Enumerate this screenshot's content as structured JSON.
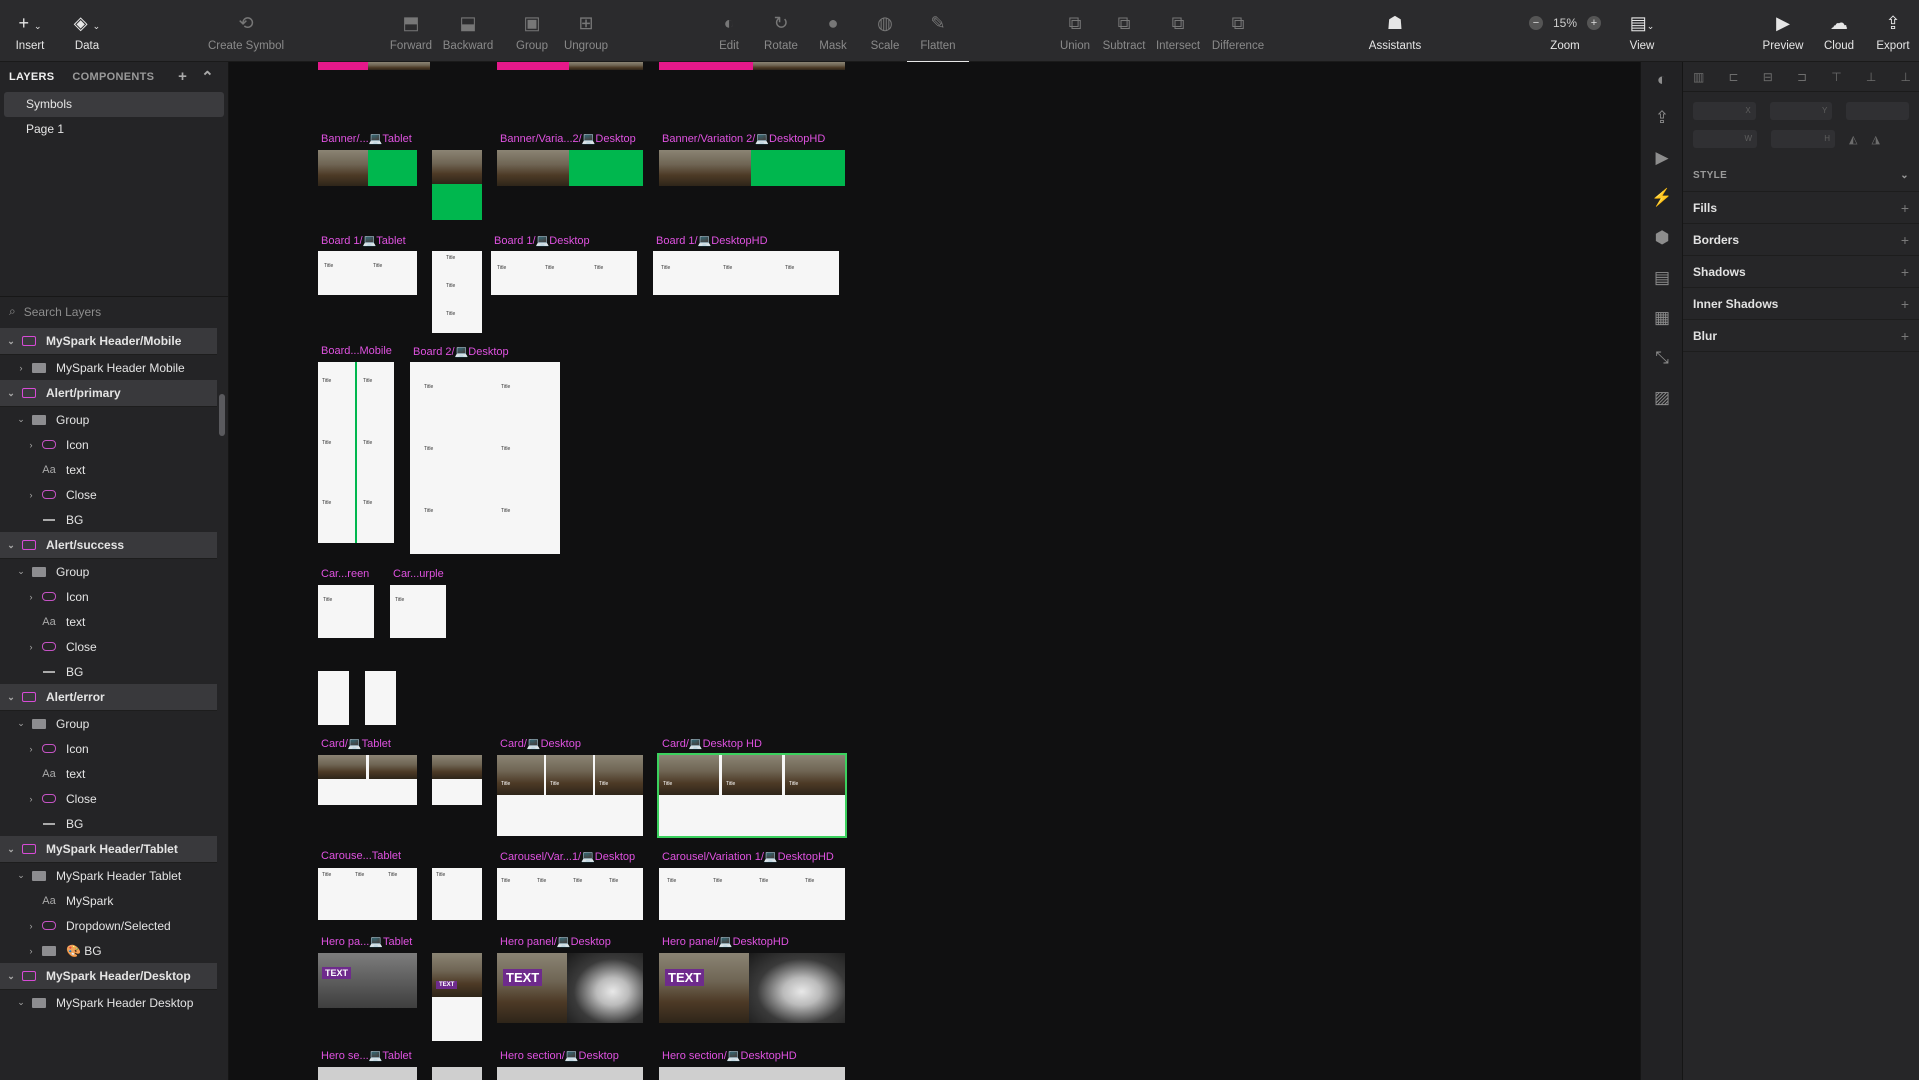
{
  "toolbar": {
    "insert": "Insert",
    "data": "Data",
    "create_symbol": "Create Symbol",
    "forward": "Forward",
    "backward": "Backward",
    "group": "Group",
    "ungroup": "Ungroup",
    "edit": "Edit",
    "rotate": "Rotate",
    "mask": "Mask",
    "scale": "Scale",
    "flatten": "Flatten",
    "union": "Union",
    "subtract": "Subtract",
    "intersect": "Intersect",
    "difference": "Difference",
    "assistants": "Assistants",
    "zoom_value": "15%",
    "zoom": "Zoom",
    "view": "View",
    "preview": "Preview",
    "cloud": "Cloud",
    "export": "Export"
  },
  "left_panel": {
    "tab_layers": "LAYERS",
    "tab_components": "COMPONENTS",
    "pages": [
      "Symbols",
      "Page 1"
    ],
    "search_placeholder": "Search Layers",
    "layers": [
      {
        "label": "MySpark Header/Mobile",
        "type": "symbol",
        "depth": 0,
        "chev": "open"
      },
      {
        "label": "MySpark Header Mobile",
        "type": "folder",
        "depth": 1,
        "chev": "closed"
      },
      {
        "label": "Alert/primary",
        "type": "symbol",
        "depth": 0,
        "chev": "open"
      },
      {
        "label": "Group",
        "type": "folder",
        "depth": 1,
        "chev": "open"
      },
      {
        "label": "Icon",
        "type": "icon",
        "depth": 2,
        "chev": "closed"
      },
      {
        "label": "text",
        "type": "text",
        "depth": 2,
        "chev": "none"
      },
      {
        "label": "Close",
        "type": "icon",
        "depth": 2,
        "chev": "closed"
      },
      {
        "label": "BG",
        "type": "line",
        "depth": 2,
        "chev": "none"
      },
      {
        "label": "Alert/success",
        "type": "symbol",
        "depth": 0,
        "chev": "open"
      },
      {
        "label": "Group",
        "type": "folder",
        "depth": 1,
        "chev": "open"
      },
      {
        "label": "Icon",
        "type": "icon",
        "depth": 2,
        "chev": "closed"
      },
      {
        "label": "text",
        "type": "text",
        "depth": 2,
        "chev": "none"
      },
      {
        "label": "Close",
        "type": "icon",
        "depth": 2,
        "chev": "closed"
      },
      {
        "label": "BG",
        "type": "line",
        "depth": 2,
        "chev": "none"
      },
      {
        "label": "Alert/error",
        "type": "symbol",
        "depth": 0,
        "chev": "open"
      },
      {
        "label": "Group",
        "type": "folder",
        "depth": 1,
        "chev": "open"
      },
      {
        "label": "Icon",
        "type": "icon",
        "depth": 2,
        "chev": "closed"
      },
      {
        "label": "text",
        "type": "text",
        "depth": 2,
        "chev": "none"
      },
      {
        "label": "Close",
        "type": "icon",
        "depth": 2,
        "chev": "closed"
      },
      {
        "label": "BG",
        "type": "line",
        "depth": 2,
        "chev": "none"
      },
      {
        "label": "MySpark Header/Tablet",
        "type": "symbol",
        "depth": 0,
        "chev": "open"
      },
      {
        "label": "MySpark Header Tablet",
        "type": "folder",
        "depth": 1,
        "chev": "open"
      },
      {
        "label": "MySpark",
        "type": "text",
        "depth": 2,
        "chev": "none"
      },
      {
        "label": "Dropdown/Selected",
        "type": "icon",
        "depth": 2,
        "chev": "closed"
      },
      {
        "label": "🎨 BG",
        "type": "folder",
        "depth": 2,
        "chev": "closed"
      },
      {
        "label": "MySpark Header/Desktop",
        "type": "symbol",
        "depth": 0,
        "chev": "open"
      },
      {
        "label": "MySpark Header Desktop",
        "type": "folder",
        "depth": 1,
        "chev": "open"
      }
    ]
  },
  "canvas": {
    "labels": {
      "banner_tablet": "Banner/...💻Tablet",
      "banner_desktop": "Banner/Varia...2/💻Desktop",
      "banner_desktophd": "Banner/Variation 2/💻DesktopHD",
      "board1_tablet": "Board 1/💻Tablet",
      "board1_desktop": "Board 1/💻Desktop",
      "board1_desktophd": "Board 1/💻DesktopHD",
      "board_mobile": "Board...Mobile",
      "board2_desktop": "Board 2/💻Desktop",
      "car_green": "Car...reen",
      "car_purple": "Car...urple",
      "card_tablet": "Card/💻Tablet",
      "card_desktop": "Card/💻Desktop",
      "card_desktophd": "Card/💻Desktop HD",
      "carousel_tablet": "Carouse...Tablet",
      "carousel_desktop": "Carousel/Var...1/💻Desktop",
      "carousel_desktophd": "Carousel/Variation 1/💻DesktopHD",
      "hero_panel_tablet": "Hero pa...💻Tablet",
      "hero_panel_desktop": "Hero panel/💻Desktop",
      "hero_panel_desktophd": "Hero panel/💻DesktopHD",
      "hero_section_tablet": "Hero se...💻Tablet",
      "hero_section_desktop": "Hero section/💻Desktop",
      "hero_section_desktophd": "Hero section/💻DesktopHD"
    },
    "mini": {
      "title": "Title",
      "text": "TEXT"
    }
  },
  "inspector": {
    "field_x": "X",
    "field_y": "Y",
    "field_w": "W",
    "field_h": "H",
    "style": "STYLE",
    "props": [
      "Fills",
      "Borders",
      "Shadows",
      "Inner Shadows",
      "Blur"
    ]
  },
  "colors": {
    "accent_label": "#df52e0",
    "selection": "#3bd15e",
    "green_panel": "#00b74e",
    "pink_panel": "#e5188a",
    "hero_purple": "#6e2b8c"
  }
}
